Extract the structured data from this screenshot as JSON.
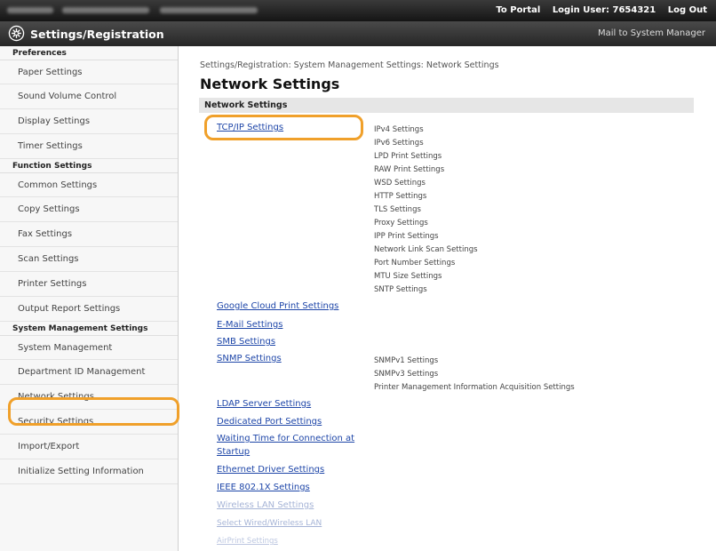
{
  "topbar": {
    "portal_label": "To Portal",
    "login_user": "Login User: 7654321",
    "logout_label": "Log Out"
  },
  "header": {
    "title": "Settings/Registration",
    "mailto": "Mail to System Manager"
  },
  "sidebar": {
    "preferences": {
      "heading": "Preferences",
      "items": [
        "Paper Settings",
        "Sound Volume Control",
        "Display Settings",
        "Timer Settings"
      ]
    },
    "function": {
      "heading": "Function Settings",
      "items": [
        "Common Settings",
        "Copy Settings",
        "Fax Settings",
        "Scan Settings",
        "Printer Settings",
        "Output Report Settings"
      ]
    },
    "system": {
      "heading": "System Management Settings",
      "items": [
        "System Management",
        "Department ID Management",
        "Network Settings",
        "Security Settings",
        "Import/Export",
        "Initialize Setting Information"
      ]
    },
    "selected": "Network Settings"
  },
  "main": {
    "breadcrumb": "Settings/Registration: System Management Settings: Network Settings",
    "title": "Network Settings",
    "section": "Network Settings",
    "tcpip_label": "TCP/IP Settings",
    "tcpip_subs": [
      "IPv4 Settings",
      "IPv6 Settings",
      "LPD Print Settings",
      "RAW Print Settings",
      "WSD Settings",
      "HTTP Settings",
      "TLS Settings",
      "Proxy Settings",
      "IPP Print Settings",
      "Network Link Scan Settings",
      "Port Number Settings",
      "MTU Size Settings",
      "SNTP Settings"
    ],
    "google_cloud": "Google Cloud Print Settings",
    "email": "E-Mail Settings",
    "smb": "SMB Settings",
    "snmp": "SNMP Settings",
    "snmp_subs": [
      "SNMPv1 Settings",
      "SNMPv3 Settings",
      "Printer Management Information Acquisition Settings"
    ],
    "ldap": "LDAP Server Settings",
    "dedicated_port": "Dedicated Port Settings",
    "waiting_time_1": "Waiting Time for Connection at",
    "waiting_time_2": "Startup",
    "ethernet": "Ethernet Driver Settings",
    "ieee": "IEEE 802.1X Settings",
    "wireless": "Wireless LAN Settings",
    "select_wired": "Select Wired/Wireless LAN",
    "airprint": "AirPrint Settings"
  },
  "colors": {
    "highlight": "#f0a02a",
    "link": "#1e46a8"
  }
}
